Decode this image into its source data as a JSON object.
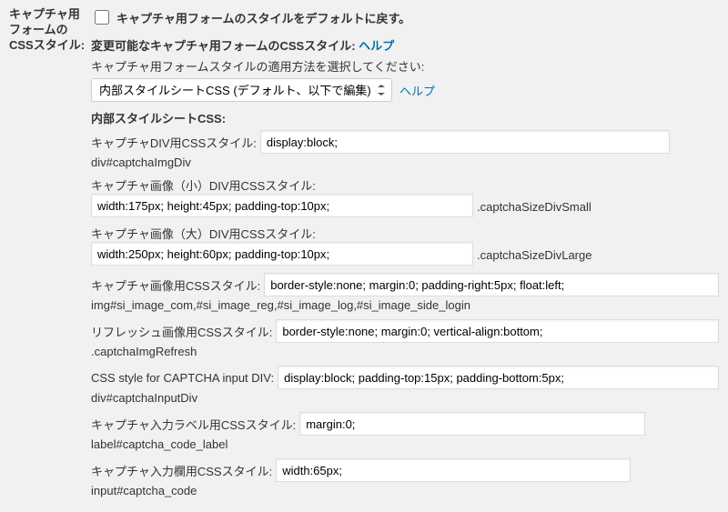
{
  "leftHeading": "キャプチャ用フォームのCSSスタイル:",
  "checkboxLabel": "キャプチャ用フォームのスタイルをデフォルトに戻す。",
  "changeableLabel": "変更可能なキャプチャ用フォームのCSSスタイル:",
  "helpLink": "ヘルプ",
  "selectInstruction": "キャプチャ用フォームスタイルの適用方法を選択してください:",
  "selectValue": "内部スタイルシートCSS (デフォルト、以下で編集)",
  "internalCssLabel": "内部スタイルシートCSS:",
  "fields": {
    "div": {
      "label": "キャプチャDIV用CSSスタイル:",
      "value": "display:block;",
      "selector": "div#captchaImgDiv"
    },
    "small": {
      "label": "キャプチャ画像（小）DIV用CSSスタイル:",
      "value": "width:175px; height:45px; padding-top:10px;",
      "selector": ".captchaSizeDivSmall"
    },
    "large": {
      "label": "キャプチャ画像（大）DIV用CSSスタイル:",
      "value": "width:250px; height:60px; padding-top:10px;",
      "selector": ".captchaSizeDivLarge"
    },
    "img": {
      "label": "キャプチャ画像用CSSスタイル:",
      "value": "border-style:none; margin:0; padding-right:5px; float:left;",
      "selector": "img#si_image_com,#si_image_reg,#si_image_log,#si_image_side_login"
    },
    "refresh": {
      "label": "リフレッシュ画像用CSSスタイル:",
      "value": "border-style:none; margin:0; vertical-align:bottom;",
      "selector": ".captchaImgRefresh"
    },
    "inputDiv": {
      "label": "CSS style for CAPTCHA input DIV:",
      "value": "display:block; padding-top:15px; padding-bottom:5px;",
      "selector": "div#captchaInputDiv"
    },
    "inputLabel": {
      "label": "キャプチャ入力ラベル用CSSスタイル:",
      "value": "margin:0;",
      "selector": "label#captcha_code_label"
    },
    "inputField": {
      "label": "キャプチャ入力欄用CSSスタイル:",
      "value": "width:65px;",
      "selector": "input#captcha_code"
    }
  }
}
